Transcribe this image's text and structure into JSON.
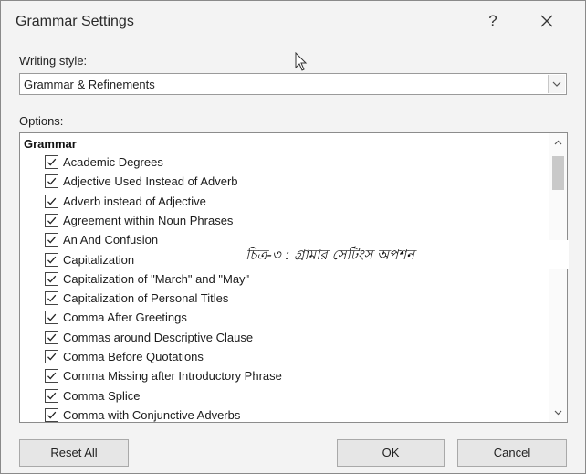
{
  "dialog": {
    "title": "Grammar Settings",
    "help_label": "?"
  },
  "writing_style": {
    "label": "Writing style:",
    "selected": "Grammar & Refinements"
  },
  "options": {
    "label": "Options:",
    "group_title": "Grammar",
    "items": [
      {
        "label": "Academic Degrees",
        "checked": true
      },
      {
        "label": "Adjective Used Instead of Adverb",
        "checked": true
      },
      {
        "label": "Adverb instead of Adjective",
        "checked": true
      },
      {
        "label": "Agreement within Noun Phrases",
        "checked": true
      },
      {
        "label": "An And Confusion",
        "checked": true
      },
      {
        "label": "Capitalization",
        "checked": true
      },
      {
        "label": "Capitalization of \"March\" and \"May\"",
        "checked": true
      },
      {
        "label": "Capitalization of Personal Titles",
        "checked": true
      },
      {
        "label": "Comma After Greetings",
        "checked": true
      },
      {
        "label": "Commas around Descriptive Clause",
        "checked": true
      },
      {
        "label": "Comma Before Quotations",
        "checked": true
      },
      {
        "label": "Comma Missing after Introductory Phrase",
        "checked": true
      },
      {
        "label": "Comma Splice",
        "checked": true
      },
      {
        "label": "Comma with Conjunctive Adverbs",
        "checked": true
      }
    ]
  },
  "buttons": {
    "reset_all": "Reset All",
    "ok": "OK",
    "cancel": "Cancel"
  },
  "caption": "চিত্র-৩ : গ্রামার সেটিংস অপশন"
}
